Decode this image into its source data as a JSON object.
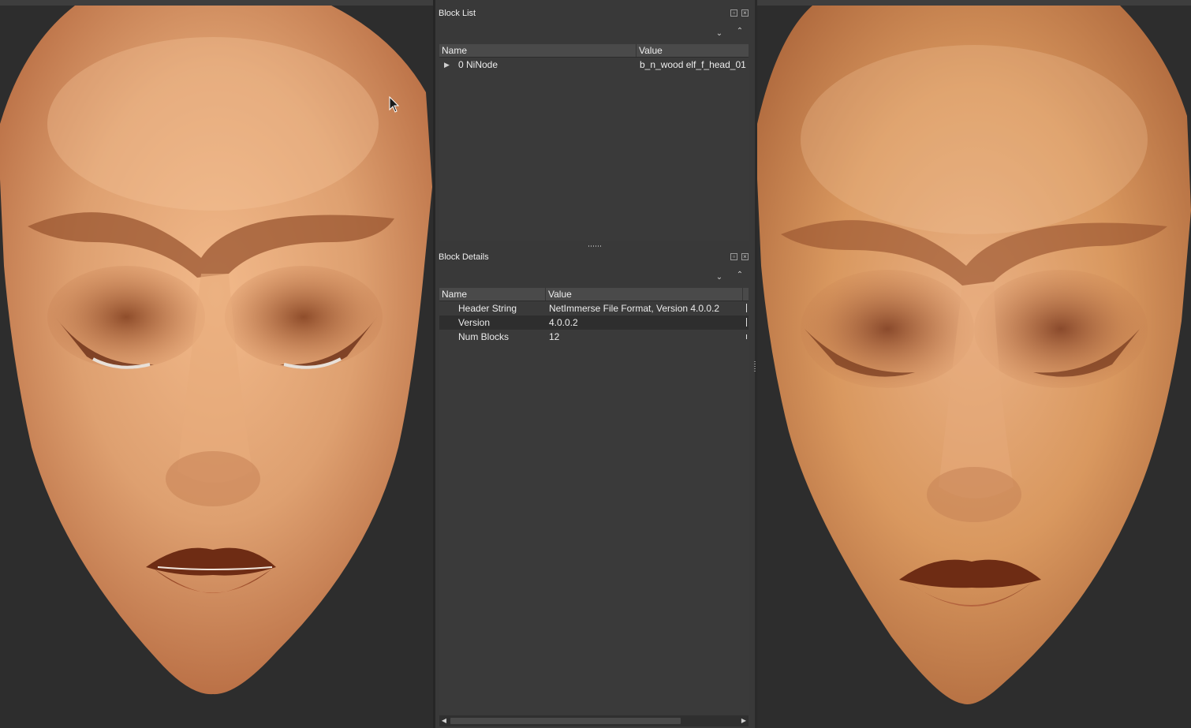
{
  "block_list": {
    "title": "Block List",
    "columns": [
      "Name",
      "Value"
    ],
    "rows": [
      {
        "name": "0 NiNode",
        "value": "b_n_wood elf_f_head_01",
        "expandable": true
      }
    ]
  },
  "block_details": {
    "title": "Block Details",
    "columns": [
      "Name",
      "Value"
    ],
    "rows": [
      {
        "name": "Header String",
        "value": "NetImmerse File Format, Version 4.0.0.2"
      },
      {
        "name": "Version",
        "value": "4.0.0.2"
      },
      {
        "name": "Num Blocks",
        "value": "12"
      }
    ]
  },
  "icons": {
    "float": "float-icon",
    "close": "close-icon",
    "collapse_all": "chevron-down-double-icon",
    "expand_all": "chevron-up-double-icon",
    "expander": "triangle-right-icon",
    "cursor": "mouse-pointer-icon"
  },
  "colors": {
    "panel_bg": "#393939",
    "header_bg": "#4a4a4a",
    "viewport_bg": "#2d2d2d",
    "skin": "#d99a68",
    "brow_shadow": "#8a4a28"
  }
}
